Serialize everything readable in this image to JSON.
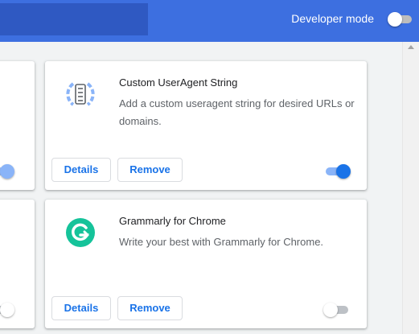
{
  "header": {
    "developer_mode_label": "Developer mode",
    "developer_mode_on": false,
    "accent_color": "#3d6fe0"
  },
  "extensions": [
    {
      "name": "Custom UserAgent String",
      "description": "Add a custom useragent string for desired URLs or domains.",
      "icon": "useragent-icon",
      "details_label": "Details",
      "remove_label": "Remove",
      "enabled": true
    },
    {
      "name": "Grammarly for Chrome",
      "description": "Write your best with Grammarly for Chrome.",
      "icon": "grammarly-icon",
      "details_label": "Details",
      "remove_label": "Remove",
      "enabled": false
    }
  ],
  "colors": {
    "toggle_on": "#1a73e8",
    "button_text": "#1a73e8",
    "grammarly_green": "#15c39a"
  }
}
